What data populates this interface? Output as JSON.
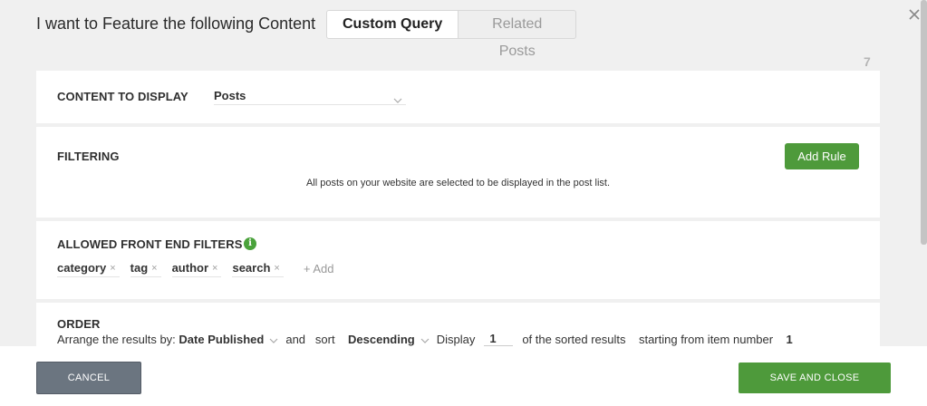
{
  "header": {
    "title": "I want to Feature the following Content",
    "tabs": [
      {
        "label": "Custom Query",
        "active": true
      },
      {
        "label": "Related Posts",
        "active": false
      }
    ],
    "close_icon": "close-icon"
  },
  "counter": "7",
  "content_display": {
    "title": "CONTENT TO DISPLAY",
    "selected": "Posts"
  },
  "filtering": {
    "title": "FILTERING",
    "add_rule_label": "Add Rule",
    "note": "All posts on your website are selected to be displayed in the post list."
  },
  "front_end_filters": {
    "title": "ALLOWED FRONT END FILTERS",
    "info_icon": "info-icon",
    "info_glyph": "i",
    "chips": [
      "category",
      "tag",
      "author",
      "search"
    ],
    "chip_remove": "×",
    "add_label": "+ Add"
  },
  "order": {
    "title": "ORDER",
    "arrange_prefix": "Arrange the results by:",
    "arrange_value": "Date Published",
    "and_text": "and",
    "sort_text": "sort",
    "sort_value": "Descending",
    "display_text": "Display",
    "display_count": "1",
    "sorted_text": "of the sorted results",
    "starting_text": "starting from item number",
    "start_item": "1"
  },
  "footer": {
    "cancel_label": "CANCEL",
    "save_label": "SAVE AND CLOSE"
  },
  "colors": {
    "accent_green": "#4e9a3b",
    "cancel_gray": "#6b7580",
    "background": "#f0f0f0"
  }
}
